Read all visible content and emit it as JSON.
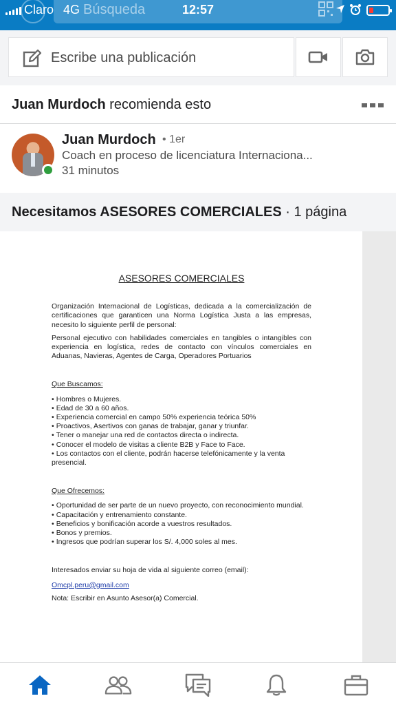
{
  "status_bar": {
    "carrier": "Claro",
    "network": "4G",
    "search_placeholder": "Búsqueda",
    "time": "12:57"
  },
  "share_box": {
    "placeholder": "Escribe una publicación",
    "icons": [
      "pencil-icon",
      "video-camera-icon",
      "camera-icon"
    ]
  },
  "post": {
    "recommender_name": "Juan Murdoch",
    "recommend_suffix": "recomienda esto",
    "author": {
      "name": "Juan Murdoch",
      "degree": "• 1er",
      "headline": "Coach en proceso de licenciatura Internaciona...",
      "time": "31 minutos"
    },
    "document": {
      "title": "Necesitamos ASESORES COMERCIALES",
      "pages": "· 1 página",
      "content": {
        "heading": "ASESORES COMERCIALES",
        "intro": "Organización Internacional de Logísticas, dedicada a la comercialización de certificaciones que garanticen una Norma Logística Justa a las empresas, necesito lo siguiente perfil de personal:",
        "profile": "Personal ejecutivo con habilidades comerciales en tangibles o intangibles con experiencia en logística, redes de contacto con vínculos comerciales en Aduanas, Navieras, Agentes de Carga, Operadores Portuarios",
        "seek_title": "Que Buscamos:",
        "seek_items": [
          "Hombres o Mujeres.",
          "Edad de 30 a 60 años.",
          "Experiencia comercial en campo 50% experiencia teórica 50%",
          "Proactivos, Asertivos con ganas de trabajar, ganar y triunfar.",
          "Tener o manejar una red de contactos directa o indirecta.",
          "Conocer el modelo de visitas a cliente B2B y Face to Face.",
          "Los contactos con el cliente, podrán hacerse telefónicamente y la venta presencial."
        ],
        "offer_title": "Que Ofrecemos:",
        "offer_items": [
          "Oportunidad de ser parte de un nuevo proyecto, con reconocimiento mundial.",
          "Capacitación y entrenamiento constante.",
          "Beneficios y bonificación acorde a vuestros resultados.",
          "Bonos y premios.",
          "Ingresos que podrían superar los S/. 4,000 soles al mes."
        ],
        "contact_text": "Interesados enviar su hoja de vida al siguiente correo (email):",
        "email": "Omcpl.peru@gmail.com",
        "note": "Nota: Escribir en Asunto Asesor(a) Comercial."
      }
    }
  },
  "bottom_nav": {
    "items": [
      "home-icon",
      "people-icon",
      "messages-icon",
      "notifications-icon",
      "jobs-icon"
    ],
    "active": "home-icon",
    "active_color": "#0a66c2",
    "inactive_color": "#7a7a7a"
  }
}
